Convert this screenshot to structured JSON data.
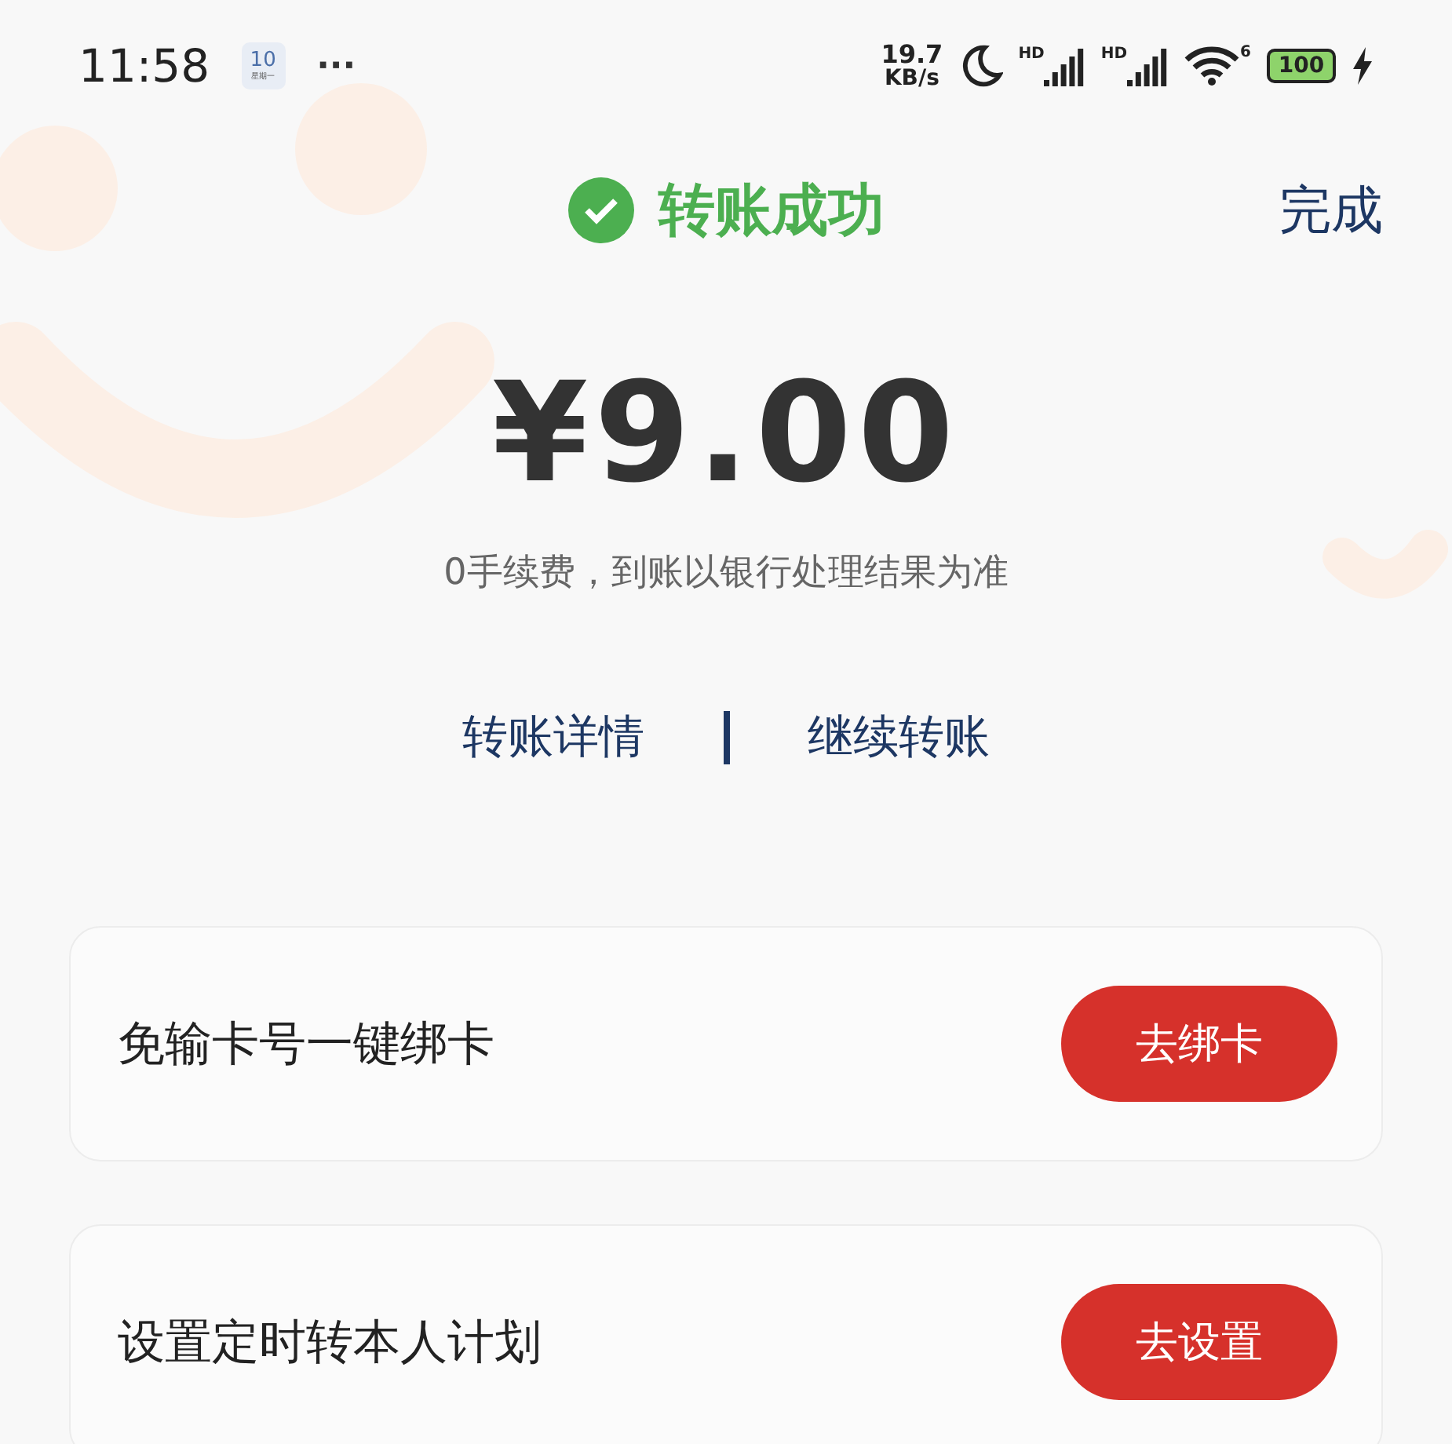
{
  "status_bar": {
    "time": "11:58",
    "calendar_day": "10",
    "calendar_label": "星期一",
    "more": "···",
    "net_speed": "19.7",
    "net_unit": "KB/s",
    "signal_label_1": "HD",
    "signal_label_2": "HD",
    "wifi_label": "6",
    "battery": "100"
  },
  "header": {
    "title": "转账成功",
    "done": "完成"
  },
  "amount": "¥9.00",
  "note": "0手续费，到账以银行处理结果为准",
  "links": [
    "转账详情",
    "继续转账"
  ],
  "cards": [
    {
      "title": "免输卡号一键绑卡",
      "button": "去绑卡"
    },
    {
      "title": "设置定时转本人计划",
      "button": "去设置"
    }
  ]
}
